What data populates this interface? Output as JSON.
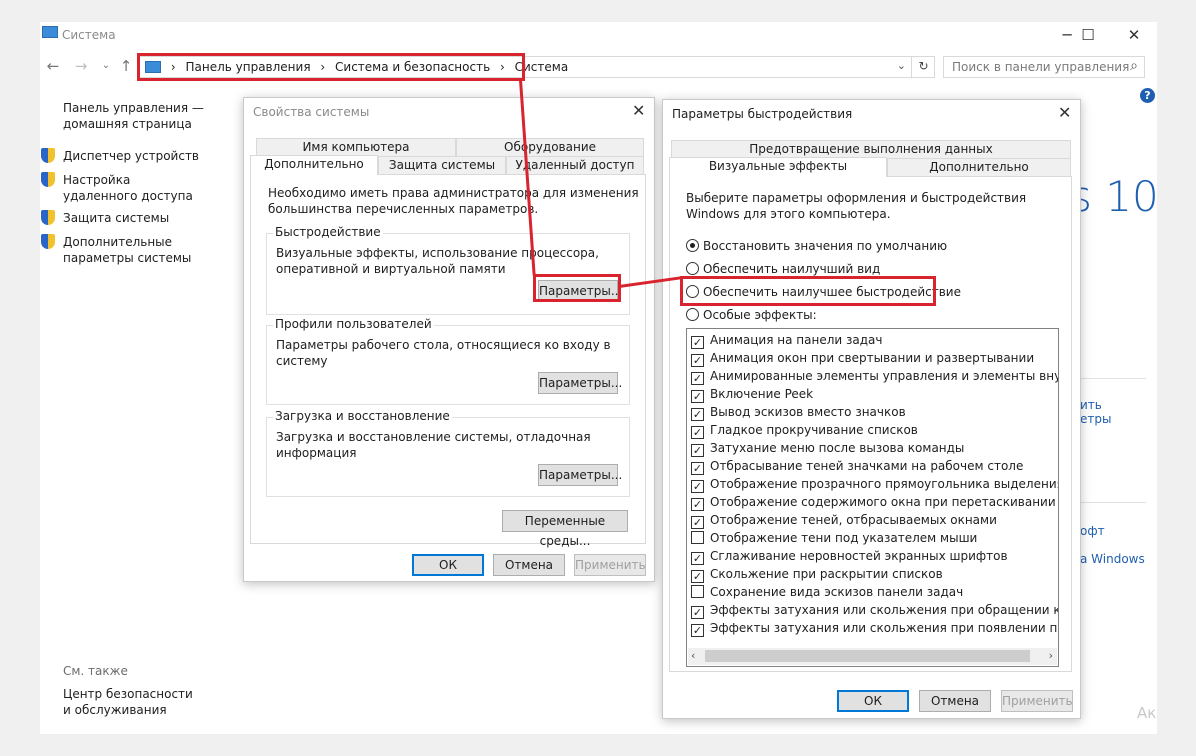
{
  "main_window": {
    "title": "Система",
    "breadcrumbs": [
      "Панель управления",
      "Система и безопасность",
      "Система"
    ],
    "search_placeholder": "Поиск в панели управления",
    "left_links": [
      {
        "label": "Панель управления — домашняя страница",
        "icon": null
      },
      {
        "label": "Диспетчер устройств",
        "icon": "shield-icon"
      },
      {
        "label": "Настройка удаленного доступа",
        "icon": "shield-icon"
      },
      {
        "label": "Защита системы",
        "icon": "shield-icon"
      },
      {
        "label": "Дополнительные параметры системы",
        "icon": "shield-icon"
      }
    ],
    "see_also": {
      "heading": "См. также",
      "link": "Центр безопасности и обслуживания"
    },
    "peek": {
      "logo_fragment": "s 10",
      "fragment_1": "ить",
      "fragment_2": "етры",
      "fragment_3": "офт",
      "fragment_4": "a Windows",
      "fragment_5": "Ак"
    }
  },
  "system_properties": {
    "title": "Свойства системы",
    "tabs_top": [
      "Имя компьютера",
      "Оборудование"
    ],
    "tabs_bottom": [
      "Дополнительно",
      "Защита системы",
      "Удаленный доступ"
    ],
    "admin_note": "Необходимо иметь права администратора для изменения большинства перечисленных параметров.",
    "performance": {
      "label": "Быстродействие",
      "text": "Визуальные эффекты, использование процессора, оперативной и виртуальной памяти",
      "button": "Параметры..."
    },
    "profiles": {
      "label": "Профили пользователей",
      "text": "Параметры рабочего стола, относящиеся ко входу в систему",
      "button": "Параметры..."
    },
    "startup": {
      "label": "Загрузка и восстановление",
      "text": "Загрузка и восстановление системы, отладочная информация",
      "button": "Параметры..."
    },
    "env_button": "Переменные среды...",
    "ok": "ОК",
    "cancel": "Отмена",
    "apply": "Применить"
  },
  "performance_options": {
    "title": "Параметры быстродействия",
    "tabs_top": [
      "Предотвращение выполнения данных"
    ],
    "tabs_bottom": [
      "Визуальные эффекты",
      "Дополнительно"
    ],
    "intro": "Выберите параметры оформления и быстродействия Windows для этого компьютера.",
    "radios": [
      {
        "label": "Восстановить значения по умолчанию",
        "selected": true
      },
      {
        "label": "Обеспечить наилучший вид",
        "selected": false
      },
      {
        "label": "Обеспечить наилучшее быстродействие",
        "selected": false
      },
      {
        "label": "Особые эффекты:",
        "selected": false
      }
    ],
    "effects": [
      {
        "label": "Анимация на панели задач",
        "checked": true
      },
      {
        "label": "Анимация окон при свертывании и развертывании",
        "checked": true
      },
      {
        "label": "Анимированные элементы управления и элементы внутри окн",
        "checked": true
      },
      {
        "label": "Включение Peek",
        "checked": true
      },
      {
        "label": "Вывод эскизов вместо значков",
        "checked": true
      },
      {
        "label": "Гладкое прокручивание списков",
        "checked": true
      },
      {
        "label": "Затухание меню после вызова команды",
        "checked": true
      },
      {
        "label": "Отбрасывание теней значками на рабочем столе",
        "checked": true
      },
      {
        "label": "Отображение прозрачного прямоугольника выделения",
        "checked": true
      },
      {
        "label": "Отображение содержимого окна при перетаскивании",
        "checked": true
      },
      {
        "label": "Отображение теней, отбрасываемых окнами",
        "checked": true
      },
      {
        "label": "Отображение тени под указателем мыши",
        "checked": false
      },
      {
        "label": "Сглаживание неровностей экранных шрифтов",
        "checked": true
      },
      {
        "label": "Скольжение при раскрытии списков",
        "checked": true
      },
      {
        "label": "Сохранение вида эскизов панели задач",
        "checked": false
      },
      {
        "label": "Эффекты затухания или скольжения при обращении к меню",
        "checked": true
      },
      {
        "label": "Эффекты затухания или скольжения при появлении подсказок",
        "checked": true
      }
    ],
    "ok": "ОК",
    "cancel": "Отмена",
    "apply": "Применить"
  },
  "colors": {
    "highlight": "#d7242f",
    "link": "#1e1e1e",
    "accent": "#0078d7"
  }
}
